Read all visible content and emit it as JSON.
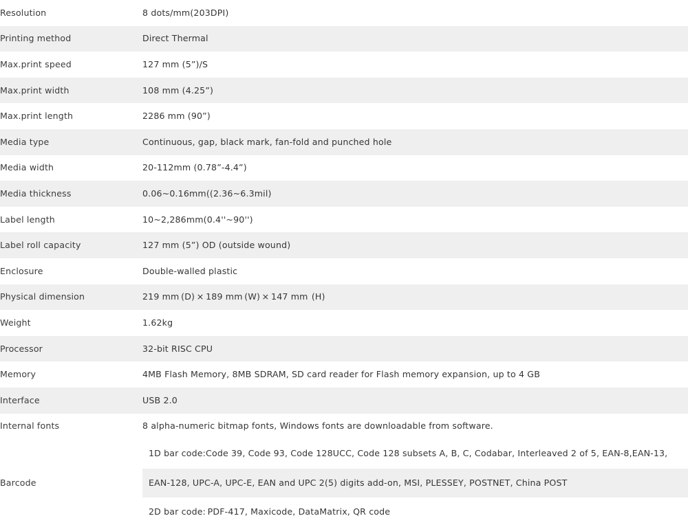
{
  "table": {
    "rows": [
      {
        "label": "Resolution",
        "value": "8 dots/mm(203DPI)",
        "shaded": false
      },
      {
        "label": "Printing method",
        "value": "Direct Thermal",
        "shaded": true
      },
      {
        "label": "Max.print speed",
        "value": "127 mm (5”)/S",
        "shaded": false
      },
      {
        "label": "Max.print width",
        "value": "108 mm (4.25”)",
        "shaded": true
      },
      {
        "label": "Max.print length",
        "value": "2286 mm (90”)",
        "shaded": false
      },
      {
        "label": "Media type",
        "value": "Continuous, gap, black mark, fan-fold and punched hole",
        "shaded": true
      },
      {
        "label": "Media width",
        "value": "20-112mm (0.78”-4.4”)",
        "shaded": false
      },
      {
        "label": "Media thickness",
        "value": "0.06~0.16mm((2.36~6.3mil)",
        "shaded": true
      },
      {
        "label": "Label length",
        "value": "10~2,286mm(0.4''~90'')",
        "shaded": false
      },
      {
        "label": "Label roll capacity",
        "value": "127 mm (5”) OD (outside wound)",
        "shaded": true
      },
      {
        "label": "Enclosure",
        "value": "Double-walled plastic",
        "shaded": false
      },
      {
        "label": "Physical dimension",
        "value": "219 mm (D) × 189 mm (W) × 147 mm  (H)",
        "shaded": true
      },
      {
        "label": "Weight",
        "value": "1.62kg",
        "shaded": false
      },
      {
        "label": "Processor",
        "value": "32-bit RISC CPU",
        "shaded": true
      },
      {
        "label": "Memory",
        "value": "4MB Flash Memory, 8MB SDRAM, SD card reader for Flash memory expansion, up to 4 GB",
        "shaded": false
      },
      {
        "label": "Interface",
        "value": "USB 2.0",
        "shaded": true
      },
      {
        "label": "Internal fonts",
        "value": "8 alpha-numeric bitmap fonts, Windows fonts are downloadable from software.",
        "shaded": false
      }
    ],
    "barcode_row": {
      "label": "Barcode",
      "sub_rows": [
        {
          "value": "1D bar code:Code 39, Code 93, Code 128UCC, Code 128 subsets A, B, C, Codabar, Interleaved 2 of 5, EAN-8,EAN-13,",
          "shaded": false
        },
        {
          "value": "EAN-128, UPC-A, UPC-E, EAN and UPC 2(5) digits add-on, MSI, PLESSEY, POSTNET, China POST",
          "shaded": true
        },
        {
          "value": "2D bar code: PDF-417, Maxicode, DataMatrix, QR code",
          "shaded": false
        }
      ]
    }
  },
  "colors": {
    "band_shaded": "#efefef",
    "band_plain": "#ffffff",
    "label_text": "#3c3c3c",
    "value_text": "#353535"
  }
}
